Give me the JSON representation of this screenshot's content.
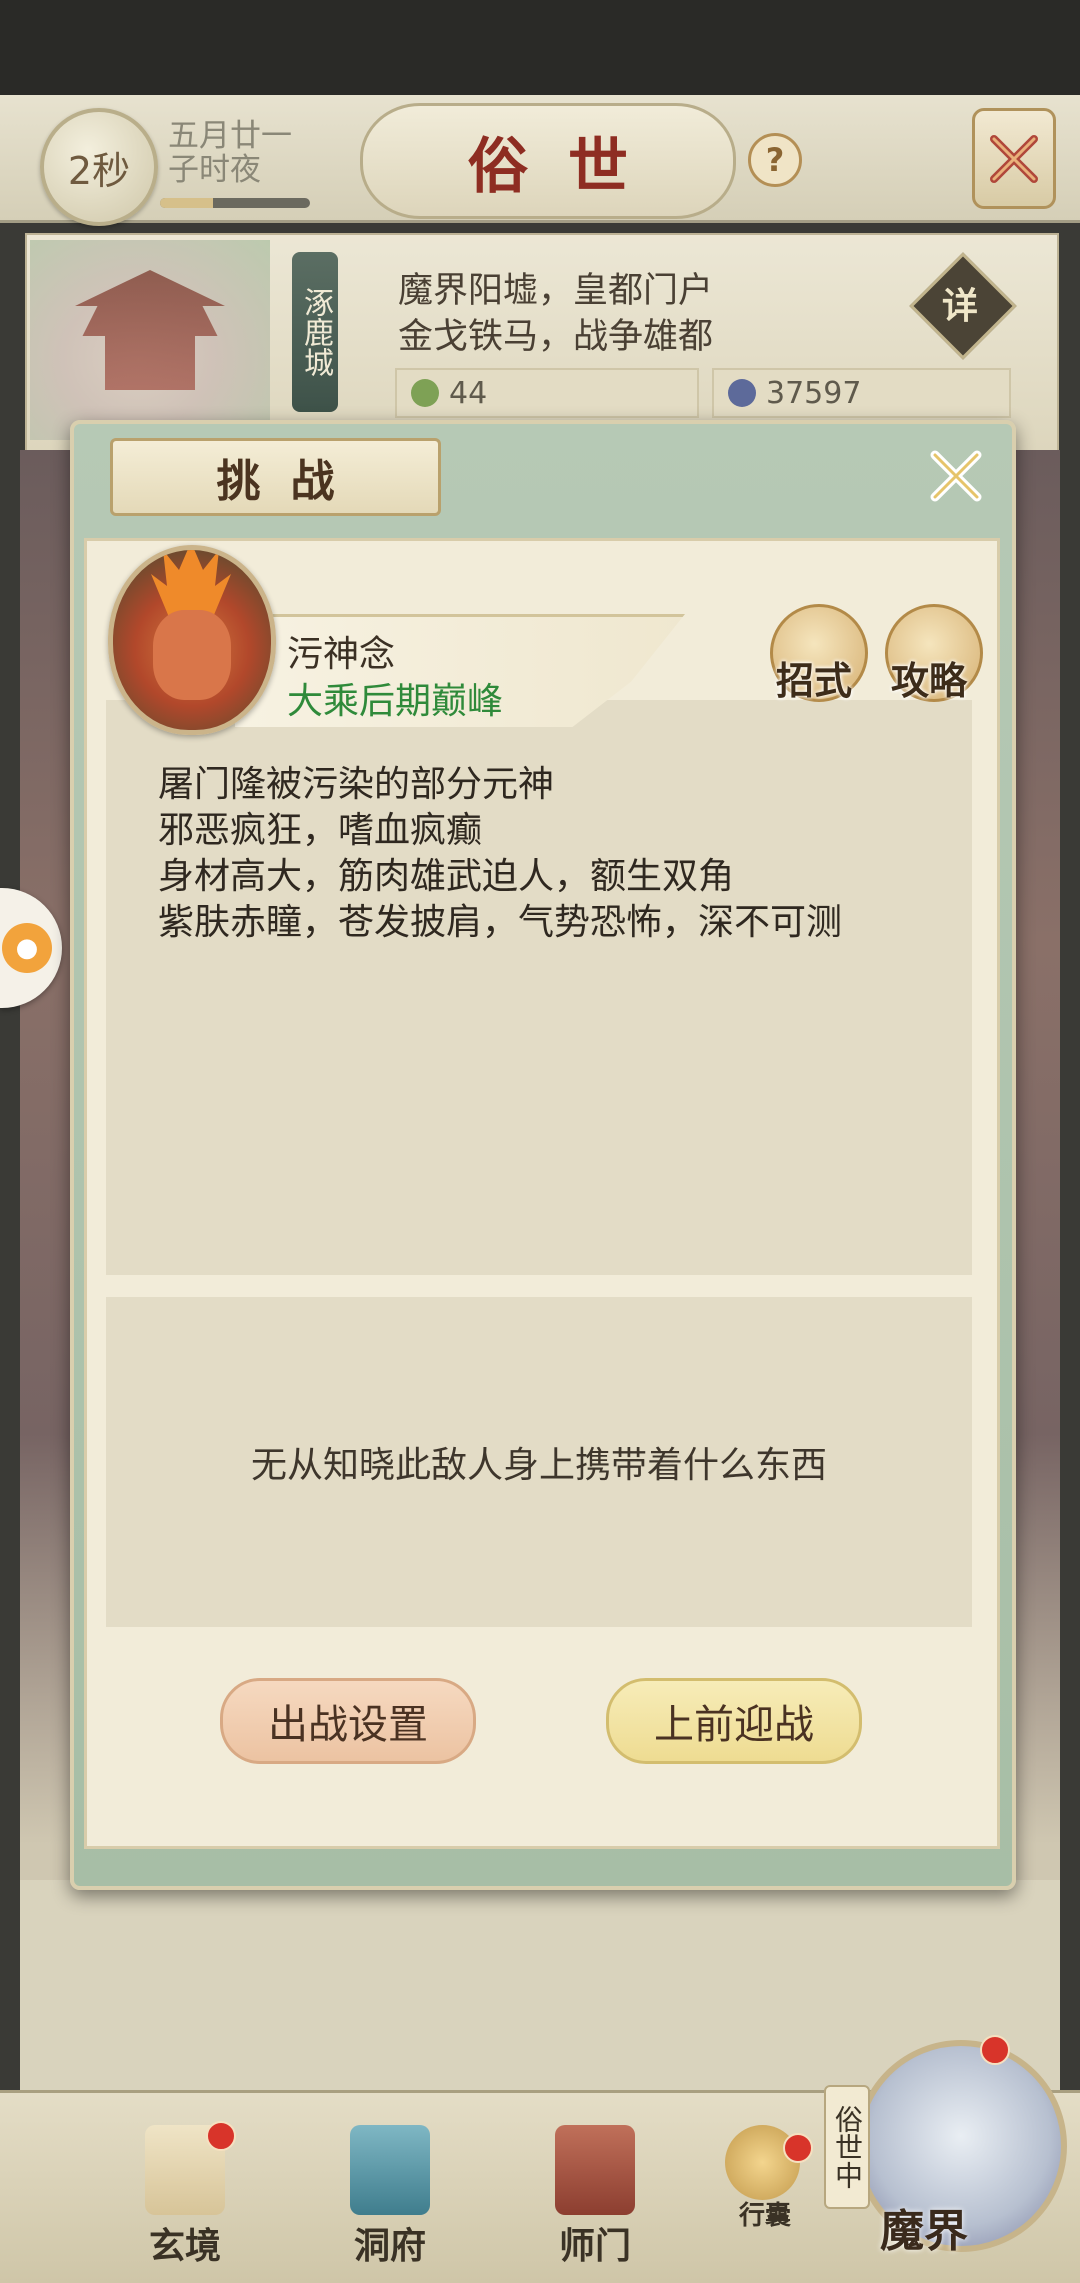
{
  "header": {
    "timer": "2秒",
    "date_line1": "五月廿一",
    "date_line2": "子时夜",
    "time_progress": 0.35,
    "title": "俗世",
    "help_symbol": "?"
  },
  "city": {
    "name": "涿鹿城",
    "desc_line1": "魔界阳墟，皇都门户",
    "desc_line2": "金戈铁马，战争雄都",
    "detail_label": "详",
    "resource_a": "44",
    "resource_b": "37597"
  },
  "dialog": {
    "title": "挑战",
    "enemy_name": "污神念",
    "enemy_rank": "大乘后期巅峰",
    "moves_label": "招式",
    "guide_label": "攻略",
    "description": [
      "屠门隆被污染的部分元神",
      "邪恶疯狂，嗜血疯癫",
      "身材高大，筋肉雄武迫人，额生双角",
      "紫肤赤瞳，苍发披肩，气势恐怖，深不可测"
    ],
    "loot_text": "无从知晓此敌人身上携带着什么东西",
    "settings_button": "出战设置",
    "fight_button": "上前迎战"
  },
  "bottom_nav": {
    "items": [
      "玄境",
      "洞府",
      "师门",
      "行囊",
      "魔界"
    ],
    "world_tag": "俗世中"
  },
  "colors": {
    "rank_green": "#2f8a3a",
    "title_red": "#8e2d22",
    "dialog_frame": "#b6c9b5"
  },
  "icons": [
    "close-icon",
    "help-icon",
    "leaf-icon",
    "coin-icon",
    "scroll-icon",
    "pavilion-icon",
    "banner-icon",
    "bag-icon"
  ]
}
